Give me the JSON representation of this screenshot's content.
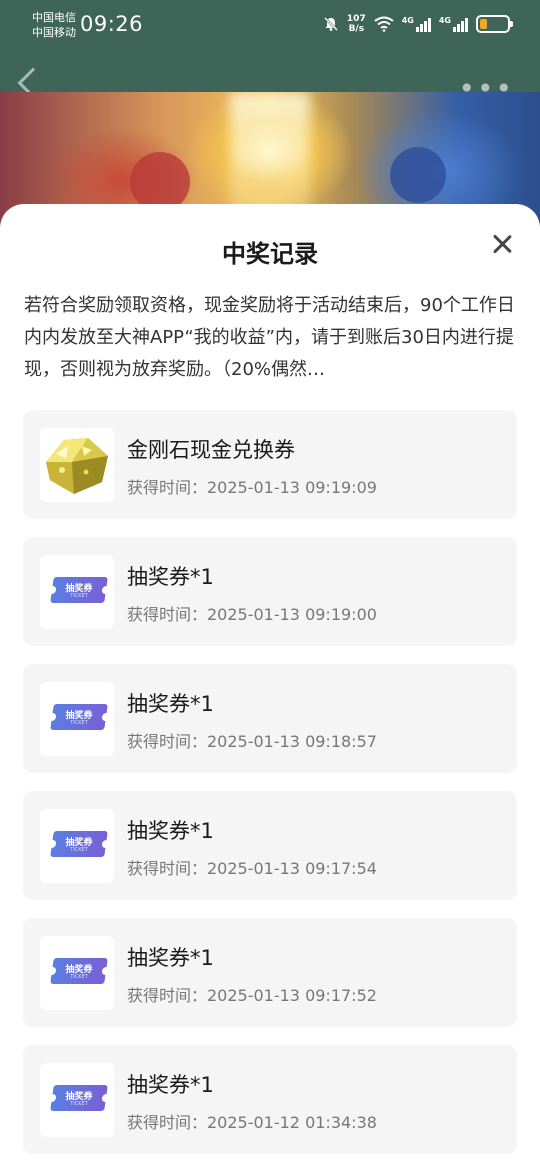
{
  "status_bar": {
    "carrier_1": "中国电信",
    "carrier_2": "中国移动",
    "time": "09:26",
    "net_speed_value": "107",
    "net_speed_unit": "B/s",
    "sim1_label": "4G",
    "sim2_label": "4G",
    "battery_level": 0.25,
    "battery_color": "#f5a623"
  },
  "app_bar": {
    "back_icon": "chevron-left-icon",
    "more_icon": "more-dots-icon"
  },
  "sheet": {
    "title": "中奖记录",
    "close_icon": "close-icon",
    "notice": "若符合奖励领取资格，现金奖励将于活动结束后，90个工作日内内发放至大神APP“我的收益”内，请于到账后30日内进行提现，否则视为放弃奖励。（20%偶然…"
  },
  "ticket_art": {
    "label": "抽奖券",
    "sub": "TICKET"
  },
  "records": [
    {
      "icon": "diamond-icon",
      "title": "金刚石现金兑换券",
      "time": "获得时间：2025-01-13 09:19:09"
    },
    {
      "icon": "ticket-icon",
      "title": "抽奖券*1",
      "time": "获得时间：2025-01-13 09:19:00"
    },
    {
      "icon": "ticket-icon",
      "title": "抽奖券*1",
      "time": "获得时间：2025-01-13 09:18:57"
    },
    {
      "icon": "ticket-icon",
      "title": "抽奖券*1",
      "time": "获得时间：2025-01-13 09:17:54"
    },
    {
      "icon": "ticket-icon",
      "title": "抽奖券*1",
      "time": "获得时间：2025-01-13 09:17:52"
    },
    {
      "icon": "ticket-icon",
      "title": "抽奖券*1",
      "time": "获得时间：2025-01-12 01:34:38"
    }
  ],
  "colors": {
    "header_bg": "#3f6558",
    "card_bg": "#f5f5f5",
    "ticket_gradient_start": "#5a7fe0",
    "ticket_gradient_end": "#7a5fd6"
  }
}
